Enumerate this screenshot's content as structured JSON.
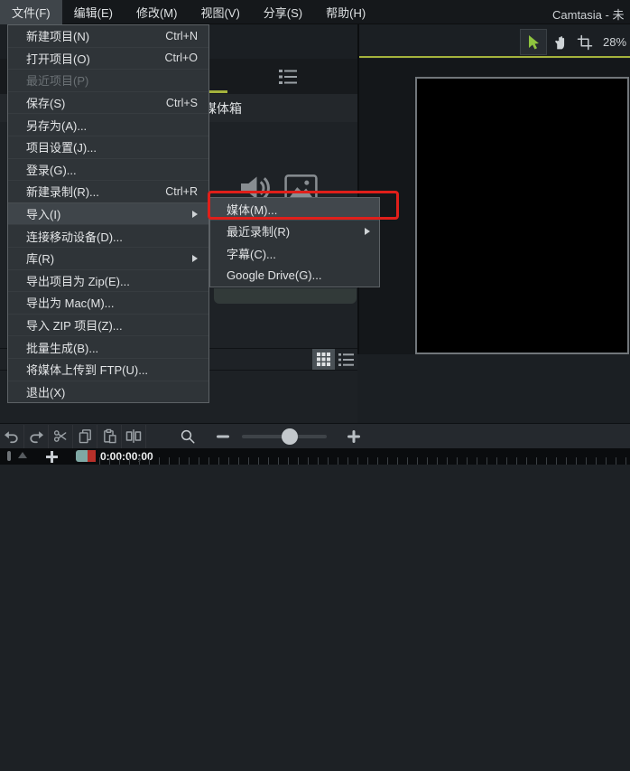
{
  "colors": {
    "accent_green": "#a4b23c",
    "annotation_red": "#e01f1a",
    "selection_gray": "#3f454a"
  },
  "menu_bar": {
    "items": [
      {
        "label": "文件(F)"
      },
      {
        "label": "编辑(E)"
      },
      {
        "label": "修改(M)"
      },
      {
        "label": "视图(V)"
      },
      {
        "label": "分享(S)"
      },
      {
        "label": "帮助(H)"
      }
    ],
    "window_title": "Camtasia - 未"
  },
  "file_menu": {
    "items": [
      {
        "label": "新建项目(N)",
        "shortcut": "Ctrl+N"
      },
      {
        "label": "打开项目(O)",
        "shortcut": "Ctrl+O"
      },
      {
        "label": "最近项目(P)"
      },
      {
        "label": "保存(S)",
        "shortcut": "Ctrl+S"
      },
      {
        "label": "另存为(A)..."
      },
      {
        "label": "项目设置(J)..."
      },
      {
        "label": "登录(G)..."
      },
      {
        "label": "新建录制(R)...",
        "shortcut": "Ctrl+R"
      },
      {
        "label": "导入(I)"
      },
      {
        "label": "连接移动设备(D)..."
      },
      {
        "label": "库(R)"
      },
      {
        "label": "导出项目为 Zip(E)..."
      },
      {
        "label": "导出为 Mac(M)..."
      },
      {
        "label": "导入 ZIP 项目(Z)..."
      },
      {
        "label": "批量生成(B)..."
      },
      {
        "label": "将媒体上传到 FTP(U)..."
      },
      {
        "label": "退出(X)"
      }
    ]
  },
  "import_submenu": {
    "items": [
      {
        "label": "媒体(M)..."
      },
      {
        "label": "最近录制(R)"
      },
      {
        "label": "字幕(C)..."
      },
      {
        "label": "Google Drive(G)..."
      }
    ]
  },
  "media_bin": {
    "title": "媒体箱"
  },
  "preview": {
    "zoom_level": "28%"
  },
  "timeline": {
    "timecode": "0:00:00;00"
  }
}
